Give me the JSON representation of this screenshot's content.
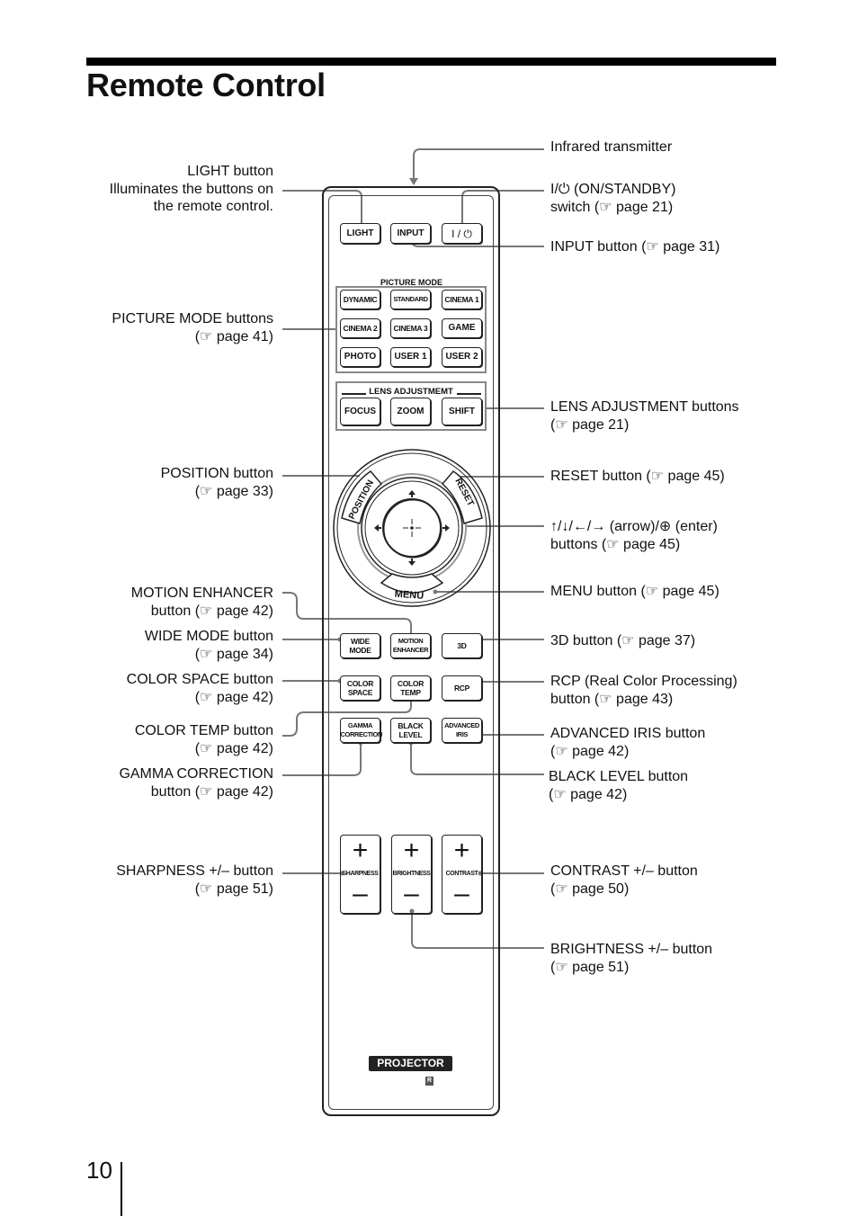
{
  "page": {
    "title": "Remote Control",
    "number": "10"
  },
  "remote": {
    "top_buttons": [
      "LIGHT",
      "INPUT",
      "I / ⏻"
    ],
    "picture_mode": {
      "label": "PICTURE MODE",
      "buttons": [
        "DYNAMIC",
        "STANDARD",
        "CINEMA 1",
        "CINEMA 2",
        "CINEMA 3",
        "GAME",
        "PHOTO",
        "USER 1",
        "USER 2"
      ]
    },
    "lens_adjustment": {
      "label": "LENS ADJUSTMEMT",
      "buttons": [
        "FOCUS",
        "ZOOM",
        "SHIFT"
      ]
    },
    "dial": {
      "position": "POSITION",
      "reset": "RESET",
      "menu": "MENU",
      "up": "↑",
      "down": "↓",
      "left": "←",
      "right": "→",
      "enter": "⊕"
    },
    "function_buttons": [
      [
        "WIDE MODE",
        "MOTION ENHANCER",
        "3D"
      ],
      [
        "COLOR SPACE",
        "COLOR TEMP",
        "RCP"
      ],
      [
        "GAMMA CORRECTION",
        "BLACK LEVEL",
        "ADVANCED IRIS"
      ]
    ],
    "rockers": [
      {
        "label": "SHARPNESS",
        "plus": "+",
        "minus": "–"
      },
      {
        "label": "BRIGHTNESS",
        "plus": "+",
        "minus": "–"
      },
      {
        "label": "CONTRAST",
        "plus": "+",
        "minus": "–"
      }
    ],
    "brand_badge": "PROJECTOR",
    "r_mark": "R"
  },
  "callouts_left": [
    {
      "l1": "LIGHT button",
      "l2": "Illuminates the buttons on",
      "l3": "the remote control."
    },
    {
      "l1": "PICTURE MODE buttons",
      "l2": "(☞ page 41)"
    },
    {
      "l1": "POSITION button",
      "l2": "(☞ page 33)"
    },
    {
      "l1": "MOTION ENHANCER",
      "l2": "button (☞ page 42)"
    },
    {
      "l1": "WIDE MODE button",
      "l2": "(☞ page 34)"
    },
    {
      "l1": "COLOR SPACE button",
      "l2": "(☞ page 42)"
    },
    {
      "l1": "COLOR TEMP button",
      "l2": "(☞ page 42)"
    },
    {
      "l1": "GAMMA CORRECTION",
      "l2": "button (☞ page 42)"
    },
    {
      "l1": "SHARPNESS +/– button",
      "l2": "(☞ page 51)"
    }
  ],
  "callouts_right": [
    {
      "l1": "Infrared transmitter"
    },
    {
      "l1": "I/⏻ (ON/STANDBY)",
      "l2": "switch (☞ page 21)"
    },
    {
      "l1": "INPUT button (☞ page 31)"
    },
    {
      "l1": "LENS ADJUSTMENT buttons",
      "l2": "(☞ page 21)"
    },
    {
      "l1": "RESET button (☞ page 45)"
    },
    {
      "l1": "↑/↓/←/→ (arrow)/⊕ (enter)",
      "l2": "buttons (☞ page 45)"
    },
    {
      "l1": "MENU button (☞ page 45)"
    },
    {
      "l1": "3D button (☞ page 37)"
    },
    {
      "l1": "RCP (Real Color Processing)",
      "l2": "button (☞ page 43)"
    },
    {
      "l1": "ADVANCED IRIS button",
      "l2": "(☞ page 42)"
    },
    {
      "l1": "BLACK LEVEL button",
      "l2": "(☞ page 42)"
    },
    {
      "l1": "CONTRAST +/– button",
      "l2": "(☞ page 50)"
    },
    {
      "l1": "BRIGHTNESS +/– button",
      "l2": "(☞ page 51)"
    }
  ]
}
